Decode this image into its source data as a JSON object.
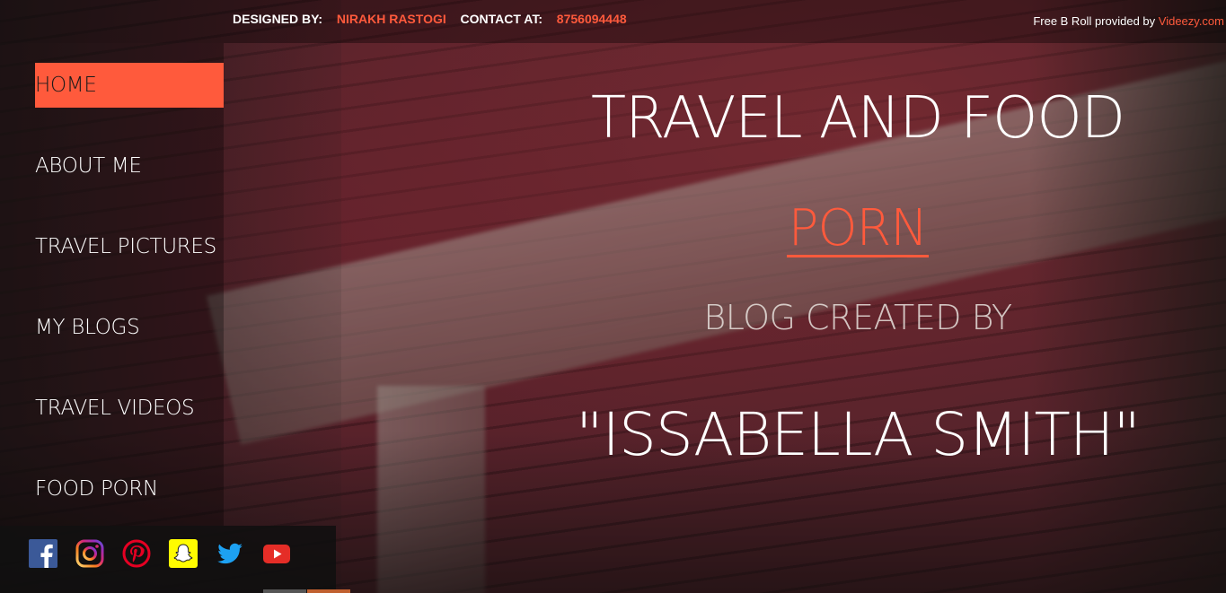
{
  "topbar": {
    "designed_by_label": "DESIGNED BY:",
    "designer_name": "NIRAKH RASTOGI",
    "contact_label": "CONTACT AT:",
    "contact_number": "8756094448",
    "attribution_text": "Free B Roll provided by ",
    "attribution_link": "Videezy.com"
  },
  "sidebar": {
    "items": [
      {
        "label": "HOME",
        "active": true
      },
      {
        "label": "ABOUT ME",
        "active": false
      },
      {
        "label": "TRAVEL PICTURES",
        "active": false
      },
      {
        "label": "MY BLOGS",
        "active": false
      },
      {
        "label": "TRAVEL VIDEOS",
        "active": false
      },
      {
        "label": "FOOD PORN",
        "active": false
      }
    ]
  },
  "social": {
    "icons": [
      "facebook-icon",
      "instagram-icon",
      "pinterest-icon",
      "snapchat-icon",
      "twitter-icon",
      "youtube-icon"
    ]
  },
  "hero": {
    "title": "TRAVEL AND FOOD",
    "accent": "PORN",
    "subtitle": "BLOG CREATED BY",
    "name": "\"ISSABELLA SMITH\""
  },
  "colors": {
    "accent": "#ff5a3c",
    "text": "#ffffff"
  }
}
